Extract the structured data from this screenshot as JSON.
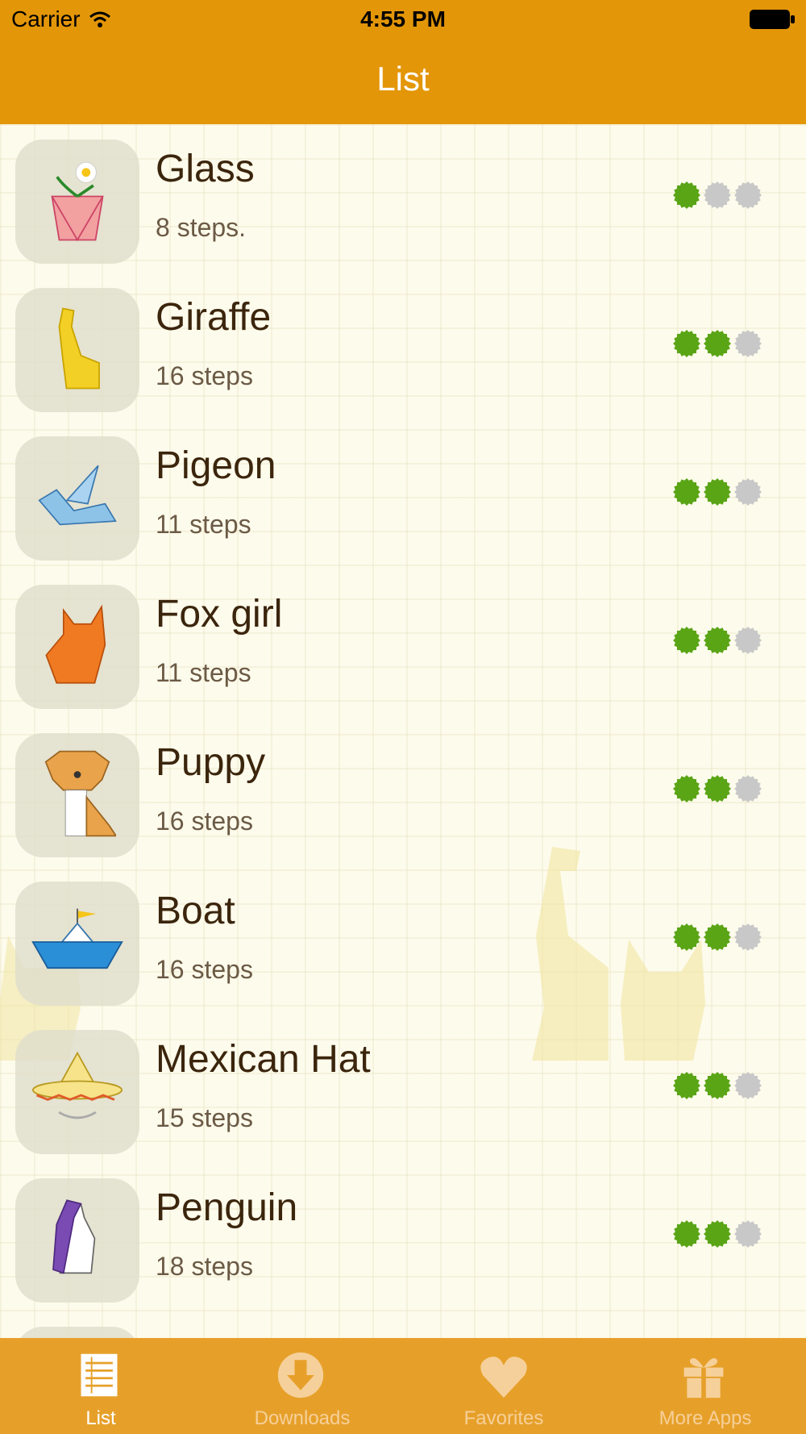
{
  "status_bar": {
    "carrier": "Carrier",
    "time": "4:55 PM"
  },
  "nav": {
    "title": "List"
  },
  "items": [
    {
      "title": "Glass",
      "subtitle": "8 steps.",
      "icon": "flower-pot-icon",
      "rating": 1
    },
    {
      "title": "Giraffe",
      "subtitle": "16 steps",
      "icon": "giraffe-icon",
      "rating": 2
    },
    {
      "title": "Pigeon",
      "subtitle": "11 steps",
      "icon": "pigeon-icon",
      "rating": 2
    },
    {
      "title": "Fox girl",
      "subtitle": "11 steps",
      "icon": "fox-icon",
      "rating": 2
    },
    {
      "title": "Puppy",
      "subtitle": "16 steps",
      "icon": "puppy-icon",
      "rating": 2
    },
    {
      "title": "Boat",
      "subtitle": "16 steps",
      "icon": "boat-icon",
      "rating": 2
    },
    {
      "title": "Mexican Hat",
      "subtitle": "15 steps",
      "icon": "sombrero-icon",
      "rating": 2
    },
    {
      "title": "Penguin",
      "subtitle": "18 steps",
      "icon": "penguin-icon",
      "rating": 2
    }
  ],
  "rating_max": 3,
  "tabs": [
    {
      "label": "List",
      "icon": "list-icon",
      "active": true
    },
    {
      "label": "Downloads",
      "icon": "download-icon",
      "active": false
    },
    {
      "label": "Favorites",
      "icon": "heart-icon",
      "active": false
    },
    {
      "label": "More Apps",
      "icon": "gift-icon",
      "active": false
    }
  ],
  "colors": {
    "header": "#e39608",
    "tab_bar": "#e6a02a",
    "rating_on": "#5aa516",
    "rating_off": "#c8c8c8",
    "title_text": "#3b250c"
  }
}
